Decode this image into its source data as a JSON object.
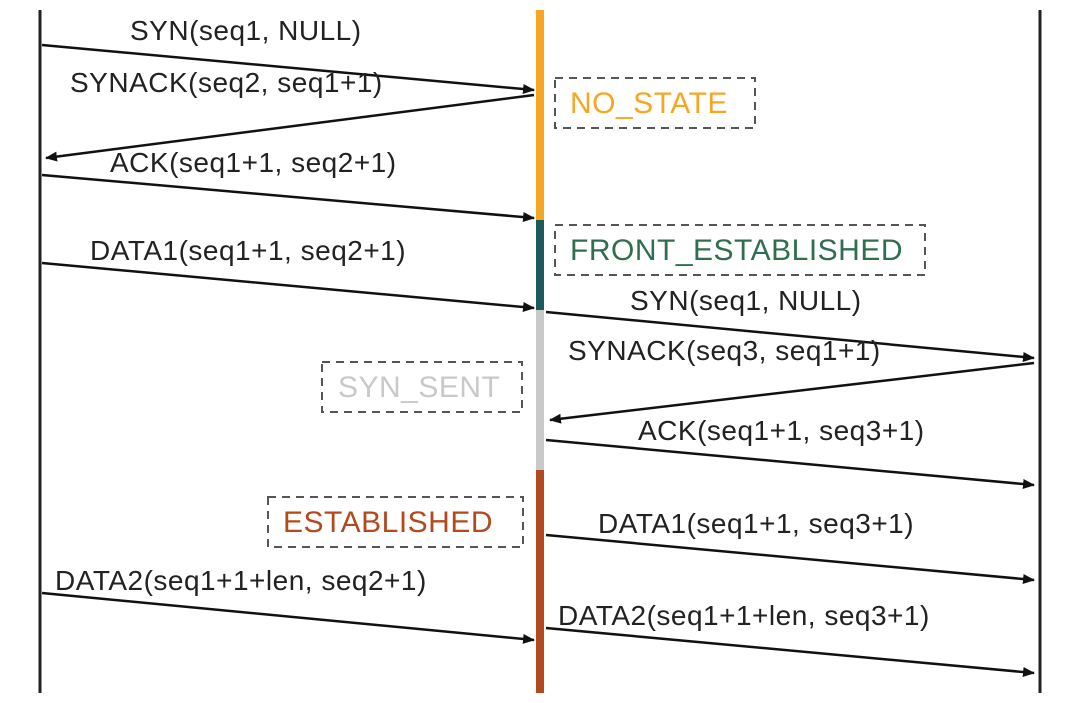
{
  "states": {
    "no_state": {
      "label": "NO_STATE",
      "color": "#f5a623"
    },
    "front_established": {
      "label": "FRONT_ESTABLISHED",
      "color": "#2f6f4f"
    },
    "syn_sent": {
      "label": "SYN_SENT",
      "color": "#c9c9c9"
    },
    "established": {
      "label": "ESTABLISHED",
      "color": "#b24a1e"
    }
  },
  "messages": {
    "left": {
      "syn": "SYN(seq1, NULL)",
      "synack": "SYNACK(seq2, seq1+1)",
      "ack": "ACK(seq1+1, seq2+1)",
      "data1": "DATA1(seq1+1, seq2+1)",
      "data2": "DATA2(seq1+1+len, seq2+1)"
    },
    "right": {
      "syn": "SYN(seq1, NULL)",
      "synack": "SYNACK(seq3, seq1+1)",
      "ack": "ACK(seq1+1, seq3+1)",
      "data1": "DATA1(seq1+1, seq3+1)",
      "data2": "DATA2(seq1+1+len, seq3+1)"
    }
  },
  "colors": {
    "segment_no_state": "#f5a623",
    "segment_front": "#1d5b5b",
    "segment_syn_sent": "#c9c9c9",
    "segment_est": "#b24a1e"
  }
}
